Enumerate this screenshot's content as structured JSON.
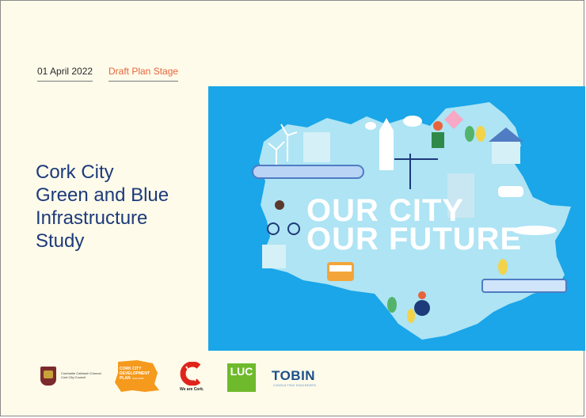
{
  "meta": {
    "date": "01 April 2022",
    "stage": "Draft Plan Stage"
  },
  "title_lines": [
    "Cork City",
    "Green and Blue",
    "Infrastructure",
    "Study"
  ],
  "illustration": {
    "headline_line1": "OUR CITY",
    "headline_line2": "OUR FUTURE",
    "background_color": "#1aa6e8",
    "land_color": "#aee4f4"
  },
  "logos": {
    "council_line1": "Comhairle Cathrach Chorcaí",
    "council_line2": "Cork City Council",
    "cdp_line1": "CORK CITY",
    "cdp_line2": "DEVELOPMENT",
    "cdp_line3": "PLAN",
    "cdp_line4": "2022-2028",
    "we_are_cork": "We are Cork.",
    "luc": "LUC",
    "tobin": "TOBIN",
    "tobin_sub": "CONSULTING ENGINEERS"
  },
  "colors": {
    "page_background": "#fefbea",
    "title_color": "#1d3a7a",
    "stage_color": "#e8643c",
    "luc_green": "#6fba2c",
    "tobin_blue": "#1d4f8a",
    "cdp_orange": "#f59a1d"
  }
}
